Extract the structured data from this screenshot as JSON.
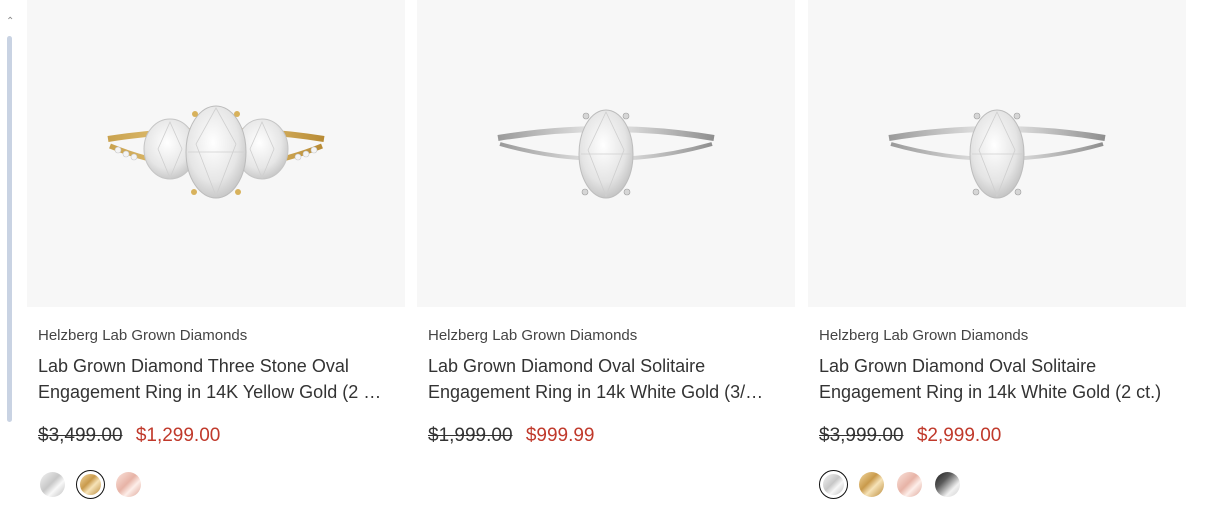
{
  "products": [
    {
      "brand": "Helzberg Lab Grown Diamonds",
      "title_line1": "Lab Grown Diamond Three Stone Oval",
      "title_line2": "Engagement Ring in 14K Yellow Gold (2 …",
      "old_price": "$3,499.00",
      "new_price": "$1,299.00",
      "image": "three-stone-oval-yellow-gold-ring-image",
      "swatches": [
        "white-gold",
        "yellow-gold",
        "rose-gold"
      ],
      "selected_swatch": "yellow-gold"
    },
    {
      "brand": "Helzberg Lab Grown Diamonds",
      "title_line1": "Lab Grown Diamond Oval Solitaire",
      "title_line2": "Engagement Ring in 14k White Gold (3/…",
      "old_price": "$1,999.00",
      "new_price": "$999.99",
      "image": "oval-solitaire-white-gold-ring-image",
      "swatches": []
    },
    {
      "brand": "Helzberg Lab Grown Diamonds",
      "title_line1": "Lab Grown Diamond Oval Solitaire",
      "title_line2": "Engagement Ring in 14k White Gold (2 ct.)",
      "old_price": "$3,999.00",
      "new_price": "$2,999.00",
      "image": "oval-solitaire-white-gold-ring-image",
      "swatches": [
        "white-gold",
        "yellow-gold",
        "rose-gold",
        "black-gold"
      ],
      "selected_swatch": "white-gold"
    }
  ],
  "colors": {
    "sale_price": "#c0392b",
    "image_background": "#f7f7f7",
    "scrollbar_thumb": "#c9d3e3"
  },
  "icons": {
    "scroll_up": "chevron-up-icon"
  }
}
